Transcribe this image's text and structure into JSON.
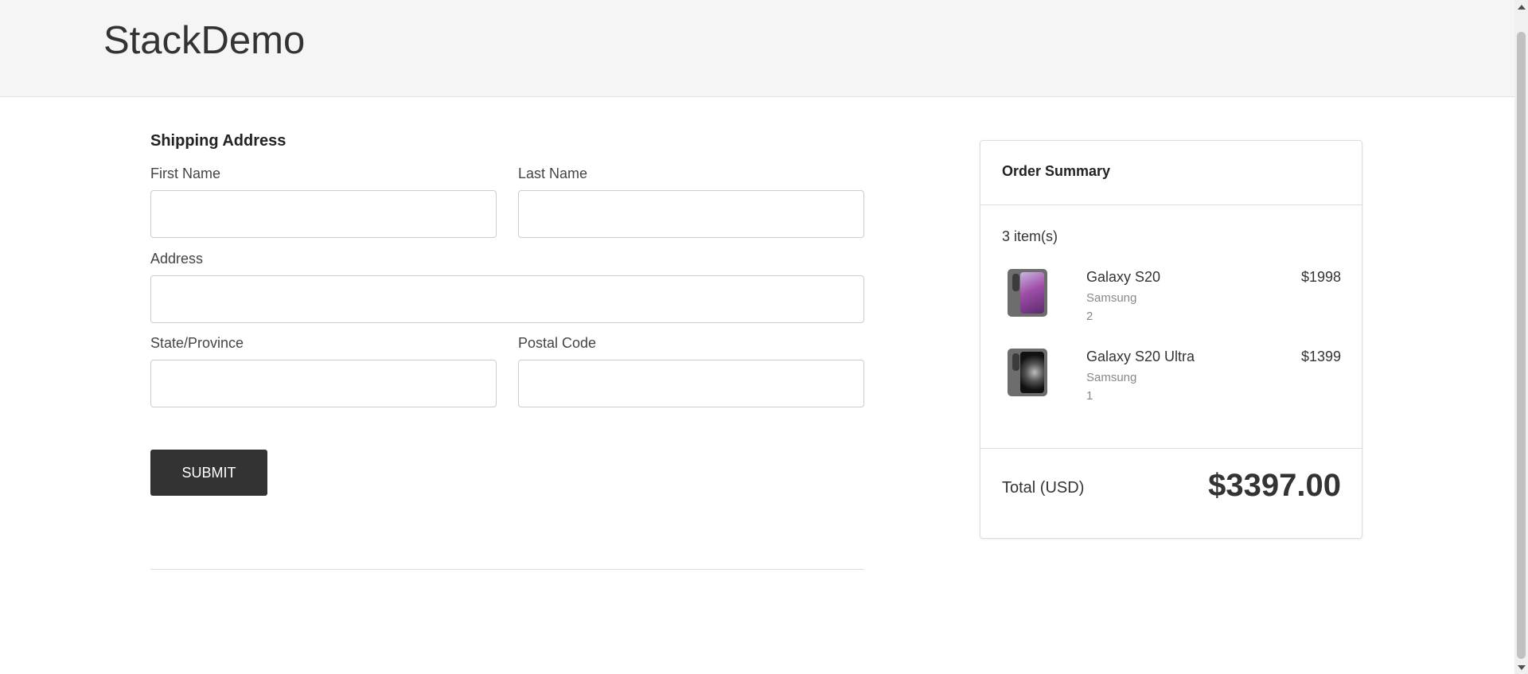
{
  "header": {
    "brand": "StackDemo"
  },
  "shipping": {
    "title": "Shipping Address",
    "first_name_label": "First Name",
    "first_name_value": "",
    "last_name_label": "Last Name",
    "last_name_value": "",
    "address_label": "Address",
    "address_value": "",
    "state_label": "State/Province",
    "state_value": "",
    "postal_label": "Postal Code",
    "postal_value": "",
    "submit_label": "SUBMIT"
  },
  "summary": {
    "title": "Order Summary",
    "item_count": "3 item(s)",
    "items": [
      {
        "name": "Galaxy S20",
        "brand": "Samsung",
        "quantity": "2",
        "price": "$1998",
        "image": "galaxy-s20-phone-image"
      },
      {
        "name": "Galaxy S20 Ultra",
        "brand": "Samsung",
        "quantity": "1",
        "price": "$1399",
        "image": "galaxy-s20-ultra-phone-image"
      }
    ],
    "total_label": "Total (USD)",
    "total_value": "$3397.00"
  },
  "colors": {
    "header_bg": "#f5f5f5",
    "button_bg": "#333333",
    "text": "#333333"
  }
}
